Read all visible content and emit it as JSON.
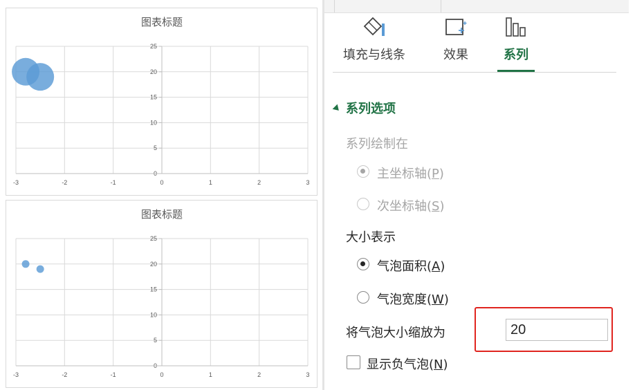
{
  "charts": [
    {
      "title": "图表标题",
      "chart_data": {
        "type": "scatter",
        "title": "图表标题",
        "bubble_size_mode": "area",
        "x_ticks": [
          "-3",
          "-2",
          "-1",
          "0",
          "1",
          "2",
          "3"
        ],
        "y_ticks": [
          "0",
          "5",
          "10",
          "15",
          "20",
          "25"
        ],
        "xlim": [
          -3,
          3
        ],
        "ylim": [
          0,
          25
        ],
        "grid": true,
        "color": "#5b9bd5",
        "points": [
          {
            "x": -2.8,
            "y": 20
          },
          {
            "x": -2.5,
            "y": 19
          }
        ]
      }
    },
    {
      "title": "图表标题",
      "chart_data": {
        "type": "scatter",
        "title": "图表标题",
        "bubble_size_mode": "width",
        "x_ticks": [
          "-3",
          "-2",
          "-1",
          "0",
          "1",
          "2",
          "3"
        ],
        "y_ticks": [
          "0",
          "5",
          "10",
          "15",
          "20",
          "25"
        ],
        "xlim": [
          -3,
          3
        ],
        "ylim": [
          0,
          25
        ],
        "grid": true,
        "color": "#5b9bd5",
        "points": [
          {
            "x": -2.8,
            "y": 20
          },
          {
            "x": -2.5,
            "y": 19
          }
        ]
      }
    }
  ],
  "format_pane": {
    "tabs": [
      {
        "label": "填充与线条",
        "icon": "paint-bucket-icon",
        "active": false
      },
      {
        "label": "效果",
        "icon": "effects-icon",
        "active": false
      },
      {
        "label": "系列",
        "icon": "series-bars-icon",
        "active": true
      }
    ],
    "section_title": "系列选项",
    "plot_on": {
      "label": "系列绘制在",
      "primary": {
        "text": "主坐标轴(",
        "key": "P",
        "close": ")"
      },
      "secondary": {
        "text": "次坐标轴(",
        "key": "S",
        "close": ")"
      }
    },
    "size_represents": {
      "label": "大小表示",
      "area": {
        "text": "气泡面积(",
        "key": "A",
        "close": ")"
      },
      "width": {
        "text": "气泡宽度(",
        "key": "W",
        "close": ")"
      }
    },
    "scale": {
      "label": "将气泡大小缩放为",
      "value": "20"
    },
    "show_negative": {
      "text": "显示负气泡(",
      "key": "N",
      "close": ")"
    }
  },
  "colors": {
    "accent": "#217346",
    "bubble": "#5b9bd5",
    "highlight": "#e0241f"
  }
}
